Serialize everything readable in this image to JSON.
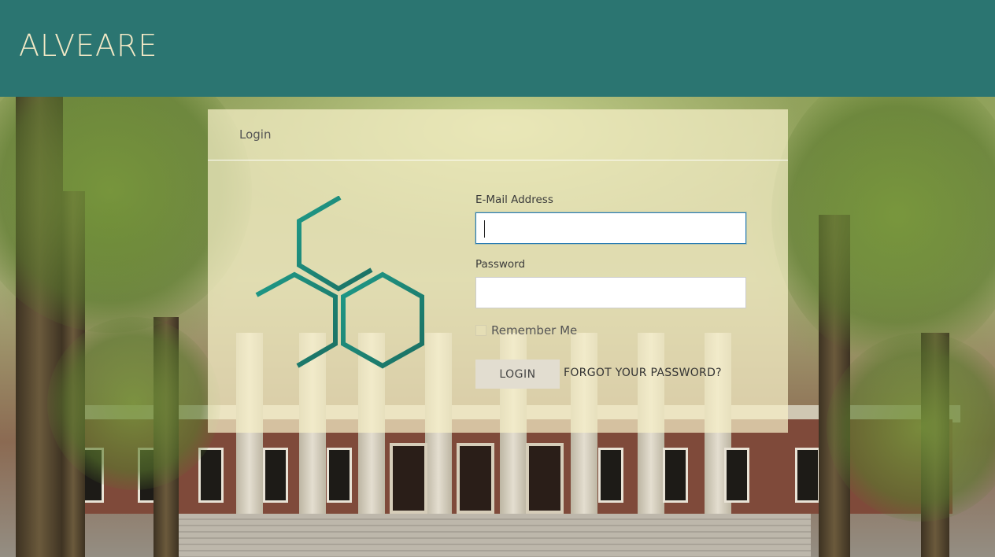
{
  "navbar": {
    "brand": "ALVEARE"
  },
  "card": {
    "title": "Login",
    "logo_icon": "hexagon-molecule-logo-icon"
  },
  "form": {
    "email_label": "E-Mail Address",
    "email_value": "",
    "password_label": "Password",
    "password_value": "",
    "remember_label": "Remember Me",
    "remember_checked": false,
    "login_button": "LOGIN",
    "forgot_link": "FORGOT YOUR PASSWORD?"
  },
  "colors": {
    "navbar": "#2b7571",
    "brand_text": "#f3e9c6",
    "card_bg": "#f6f0c8",
    "logo_teal": "#1a8a7c",
    "focus_border": "#2a7cb3"
  }
}
